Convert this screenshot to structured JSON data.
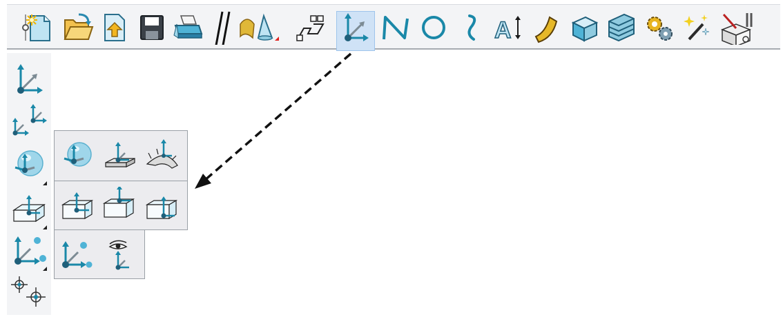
{
  "toolbar": {
    "items": [
      {
        "icon": "toolbar-grip-icon"
      },
      {
        "icon": "new-file-icon"
      },
      {
        "icon": "open-folder-icon"
      },
      {
        "icon": "upload-file-icon"
      },
      {
        "icon": "save-icon"
      },
      {
        "icon": "print-icon"
      },
      {
        "icon": "toolbar-break-icon"
      },
      {
        "icon": "surface-shapes-icon"
      },
      {
        "icon": "layers-icon"
      },
      {
        "icon": "coordinate-system-icon",
        "active": true
      },
      {
        "icon": "polyline-icon"
      },
      {
        "icon": "circle-icon"
      },
      {
        "icon": "spline-curve-icon"
      },
      {
        "icon": "text-dimension-icon"
      },
      {
        "icon": "surface-patch-icon"
      },
      {
        "icon": "solid-box-icon"
      },
      {
        "icon": "stair-solid-icon"
      },
      {
        "icon": "gears-icon"
      },
      {
        "icon": "magic-wand-icon"
      },
      {
        "icon": "toolbox-icon"
      }
    ]
  },
  "side_toolbar": {
    "items": [
      {
        "icon": "coordinate-system-icon"
      },
      {
        "icon": "dual-coordinate-system-icon"
      },
      {
        "icon": "sphere-coordinate-icon"
      },
      {
        "icon": "box-coordinate-icon"
      },
      {
        "icon": "point-coordinate-icon"
      },
      {
        "icon": "target-points-icon"
      }
    ]
  },
  "flyout": {
    "rows": [
      [
        "sphere-coordinate-icon",
        "plane-coordinate-icon",
        "surface-normal-coordinate-icon"
      ],
      [
        "box-center-coordinate-icon",
        "box-top-coordinate-icon",
        "box-corner-coordinate-icon"
      ],
      [
        "point-coordinate-icon",
        "view-coordinate-icon"
      ]
    ]
  },
  "colors": {
    "accent": "#1a88a8",
    "axis_dark": "#1f5f7a",
    "toolbar_bg": "#f3f4f6",
    "active_bg": "#cfe2f6",
    "panel_bg": "#ececef"
  }
}
